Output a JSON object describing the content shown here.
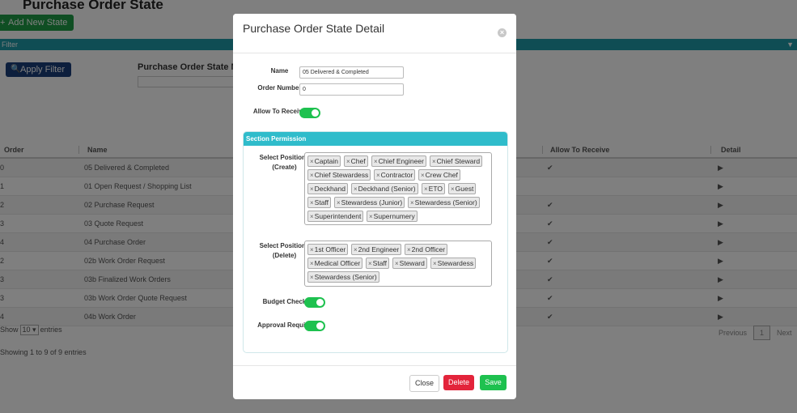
{
  "background": {
    "page_title": "Purchase Order State",
    "add_button": "Add New State",
    "filter_bar": "Filter",
    "apply_filter": "Apply Filter",
    "filter_label": "Purchase Order State Name",
    "columns": [
      "Order",
      "Name",
      "Allow To Receive",
      "Detail"
    ],
    "rows": [
      {
        "order": "0",
        "name": "05 Delivered & Completed",
        "receive": true
      },
      {
        "order": "1",
        "name": "01 Open Request / Shopping List",
        "receive": false
      },
      {
        "order": "2",
        "name": "02 Purchase Request",
        "receive": true
      },
      {
        "order": "3",
        "name": "03 Quote Request",
        "receive": true
      },
      {
        "order": "4",
        "name": "04 Purchase Order",
        "receive": true
      },
      {
        "order": "2",
        "name": "02b Work Order Request",
        "receive": true
      },
      {
        "order": "3",
        "name": "03b Finalized Work Orders",
        "receive": true
      },
      {
        "order": "3",
        "name": "03b Work Order Quote Request",
        "receive": true
      },
      {
        "order": "4",
        "name": "04b Work Order",
        "receive": true
      }
    ],
    "show_prefix": "Show",
    "show_value": "10",
    "show_suffix": "entries",
    "info": "Showing 1 to 9 of 9 entries",
    "pager_previous": "Previous",
    "pager_current": "1",
    "pager_next": "Next"
  },
  "modal": {
    "title": "Purchase Order State Detail",
    "close_icon": "×",
    "name_label": "Name",
    "name_value": "05 Delivered & Completed",
    "order_label": "Order Number",
    "order_value": "0",
    "allow_label": "Allow To Receive",
    "allow_on": true,
    "section_title": "Section Permission",
    "create_label": "Select Positions (Create)",
    "create_tags": [
      "Captain",
      "Chef",
      "Chief Engineer",
      "Chief Steward",
      "Chief Stewardess",
      "Contractor",
      "Crew Chef",
      "Deckhand",
      "Deckhand (Senior)",
      "ETO",
      "Guest",
      "Staff",
      "Stewardess (Junior)",
      "Stewardess (Senior)",
      "Superintendent",
      "Supernumery"
    ],
    "delete_label": "Select Positions (Delete)",
    "delete_tags": [
      "1st Officer",
      "2nd Engineer",
      "2nd Officer",
      "Medical Officer",
      "Staff",
      "Steward",
      "Stewardess",
      "Stewardess (Senior)"
    ],
    "budget_label": "Budget Check",
    "budget_on": true,
    "approval_label": "Approval Require",
    "approval_on": true,
    "close_button": "Close",
    "delete_button": "Delete",
    "save_button": "Save"
  }
}
